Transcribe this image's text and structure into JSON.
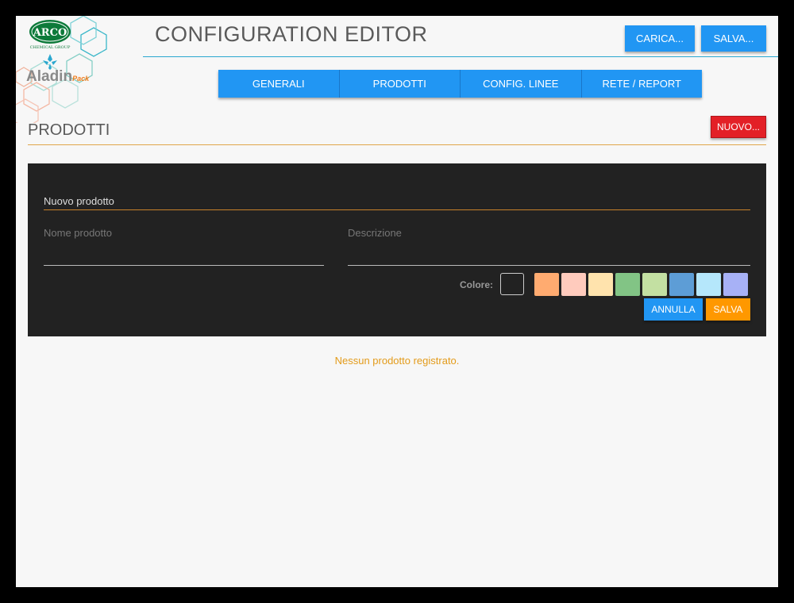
{
  "header": {
    "title": "CONFIGURATION EDITOR",
    "load_label": "CARICA...",
    "save_label": "SALVA..."
  },
  "logo": {
    "brand": "ARCO",
    "brand_sub": "CHEMICAL GROUP",
    "product": "Aladin",
    "product_suffix": "Pack"
  },
  "tabs": [
    {
      "label": "GENERALI"
    },
    {
      "label": "PRODOTTI"
    },
    {
      "label": "CONFIG. LINEE"
    },
    {
      "label": "RETE / REPORT"
    }
  ],
  "section": {
    "title": "PRODOTTI",
    "new_label": "NUOVO..."
  },
  "form": {
    "title": "Nuovo prodotto",
    "name_label": "Nome prodotto",
    "name_value": "",
    "desc_label": "Descrizione",
    "desc_value": "",
    "color_label": "Colore:",
    "colors": [
      "#ffab70",
      "#ffcbbd",
      "#ffe3ad",
      "#82c485",
      "#c3e0a2",
      "#5d9dd6",
      "#b5e7fb",
      "#a7b1f6"
    ],
    "cancel_label": "ANNULLA",
    "save_label": "SALVA"
  },
  "empty_message": "Nessun prodotto registrato.",
  "theme": {
    "accent_blue": "#2196f3",
    "danger": "#e32027",
    "warning": "#ff9800",
    "panel_bg": "#222222"
  }
}
